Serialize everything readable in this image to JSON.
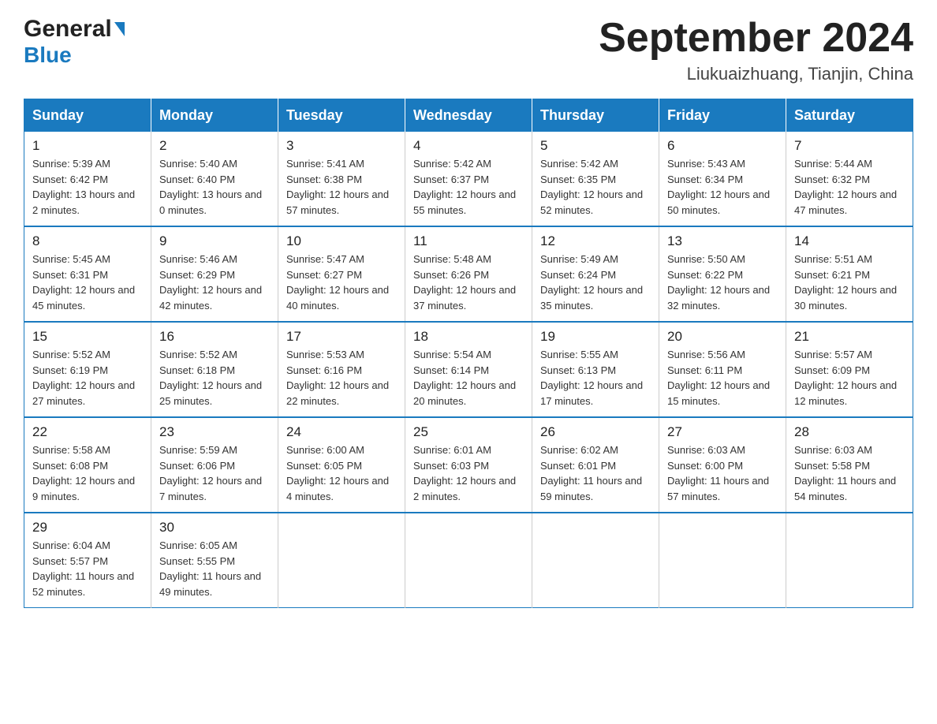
{
  "header": {
    "logo_general": "General",
    "logo_arrow": "▶",
    "logo_blue": "Blue",
    "month_title": "September 2024",
    "location": "Liukuaizhuang, Tianjin, China"
  },
  "days_of_week": [
    "Sunday",
    "Monday",
    "Tuesday",
    "Wednesday",
    "Thursday",
    "Friday",
    "Saturday"
  ],
  "weeks": [
    [
      {
        "day": "1",
        "sunrise": "Sunrise: 5:39 AM",
        "sunset": "Sunset: 6:42 PM",
        "daylight": "Daylight: 13 hours and 2 minutes."
      },
      {
        "day": "2",
        "sunrise": "Sunrise: 5:40 AM",
        "sunset": "Sunset: 6:40 PM",
        "daylight": "Daylight: 13 hours and 0 minutes."
      },
      {
        "day": "3",
        "sunrise": "Sunrise: 5:41 AM",
        "sunset": "Sunset: 6:38 PM",
        "daylight": "Daylight: 12 hours and 57 minutes."
      },
      {
        "day": "4",
        "sunrise": "Sunrise: 5:42 AM",
        "sunset": "Sunset: 6:37 PM",
        "daylight": "Daylight: 12 hours and 55 minutes."
      },
      {
        "day": "5",
        "sunrise": "Sunrise: 5:42 AM",
        "sunset": "Sunset: 6:35 PM",
        "daylight": "Daylight: 12 hours and 52 minutes."
      },
      {
        "day": "6",
        "sunrise": "Sunrise: 5:43 AM",
        "sunset": "Sunset: 6:34 PM",
        "daylight": "Daylight: 12 hours and 50 minutes."
      },
      {
        "day": "7",
        "sunrise": "Sunrise: 5:44 AM",
        "sunset": "Sunset: 6:32 PM",
        "daylight": "Daylight: 12 hours and 47 minutes."
      }
    ],
    [
      {
        "day": "8",
        "sunrise": "Sunrise: 5:45 AM",
        "sunset": "Sunset: 6:31 PM",
        "daylight": "Daylight: 12 hours and 45 minutes."
      },
      {
        "day": "9",
        "sunrise": "Sunrise: 5:46 AM",
        "sunset": "Sunset: 6:29 PM",
        "daylight": "Daylight: 12 hours and 42 minutes."
      },
      {
        "day": "10",
        "sunrise": "Sunrise: 5:47 AM",
        "sunset": "Sunset: 6:27 PM",
        "daylight": "Daylight: 12 hours and 40 minutes."
      },
      {
        "day": "11",
        "sunrise": "Sunrise: 5:48 AM",
        "sunset": "Sunset: 6:26 PM",
        "daylight": "Daylight: 12 hours and 37 minutes."
      },
      {
        "day": "12",
        "sunrise": "Sunrise: 5:49 AM",
        "sunset": "Sunset: 6:24 PM",
        "daylight": "Daylight: 12 hours and 35 minutes."
      },
      {
        "day": "13",
        "sunrise": "Sunrise: 5:50 AM",
        "sunset": "Sunset: 6:22 PM",
        "daylight": "Daylight: 12 hours and 32 minutes."
      },
      {
        "day": "14",
        "sunrise": "Sunrise: 5:51 AM",
        "sunset": "Sunset: 6:21 PM",
        "daylight": "Daylight: 12 hours and 30 minutes."
      }
    ],
    [
      {
        "day": "15",
        "sunrise": "Sunrise: 5:52 AM",
        "sunset": "Sunset: 6:19 PM",
        "daylight": "Daylight: 12 hours and 27 minutes."
      },
      {
        "day": "16",
        "sunrise": "Sunrise: 5:52 AM",
        "sunset": "Sunset: 6:18 PM",
        "daylight": "Daylight: 12 hours and 25 minutes."
      },
      {
        "day": "17",
        "sunrise": "Sunrise: 5:53 AM",
        "sunset": "Sunset: 6:16 PM",
        "daylight": "Daylight: 12 hours and 22 minutes."
      },
      {
        "day": "18",
        "sunrise": "Sunrise: 5:54 AM",
        "sunset": "Sunset: 6:14 PM",
        "daylight": "Daylight: 12 hours and 20 minutes."
      },
      {
        "day": "19",
        "sunrise": "Sunrise: 5:55 AM",
        "sunset": "Sunset: 6:13 PM",
        "daylight": "Daylight: 12 hours and 17 minutes."
      },
      {
        "day": "20",
        "sunrise": "Sunrise: 5:56 AM",
        "sunset": "Sunset: 6:11 PM",
        "daylight": "Daylight: 12 hours and 15 minutes."
      },
      {
        "day": "21",
        "sunrise": "Sunrise: 5:57 AM",
        "sunset": "Sunset: 6:09 PM",
        "daylight": "Daylight: 12 hours and 12 minutes."
      }
    ],
    [
      {
        "day": "22",
        "sunrise": "Sunrise: 5:58 AM",
        "sunset": "Sunset: 6:08 PM",
        "daylight": "Daylight: 12 hours and 9 minutes."
      },
      {
        "day": "23",
        "sunrise": "Sunrise: 5:59 AM",
        "sunset": "Sunset: 6:06 PM",
        "daylight": "Daylight: 12 hours and 7 minutes."
      },
      {
        "day": "24",
        "sunrise": "Sunrise: 6:00 AM",
        "sunset": "Sunset: 6:05 PM",
        "daylight": "Daylight: 12 hours and 4 minutes."
      },
      {
        "day": "25",
        "sunrise": "Sunrise: 6:01 AM",
        "sunset": "Sunset: 6:03 PM",
        "daylight": "Daylight: 12 hours and 2 minutes."
      },
      {
        "day": "26",
        "sunrise": "Sunrise: 6:02 AM",
        "sunset": "Sunset: 6:01 PM",
        "daylight": "Daylight: 11 hours and 59 minutes."
      },
      {
        "day": "27",
        "sunrise": "Sunrise: 6:03 AM",
        "sunset": "Sunset: 6:00 PM",
        "daylight": "Daylight: 11 hours and 57 minutes."
      },
      {
        "day": "28",
        "sunrise": "Sunrise: 6:03 AM",
        "sunset": "Sunset: 5:58 PM",
        "daylight": "Daylight: 11 hours and 54 minutes."
      }
    ],
    [
      {
        "day": "29",
        "sunrise": "Sunrise: 6:04 AM",
        "sunset": "Sunset: 5:57 PM",
        "daylight": "Daylight: 11 hours and 52 minutes."
      },
      {
        "day": "30",
        "sunrise": "Sunrise: 6:05 AM",
        "sunset": "Sunset: 5:55 PM",
        "daylight": "Daylight: 11 hours and 49 minutes."
      },
      null,
      null,
      null,
      null,
      null
    ]
  ]
}
